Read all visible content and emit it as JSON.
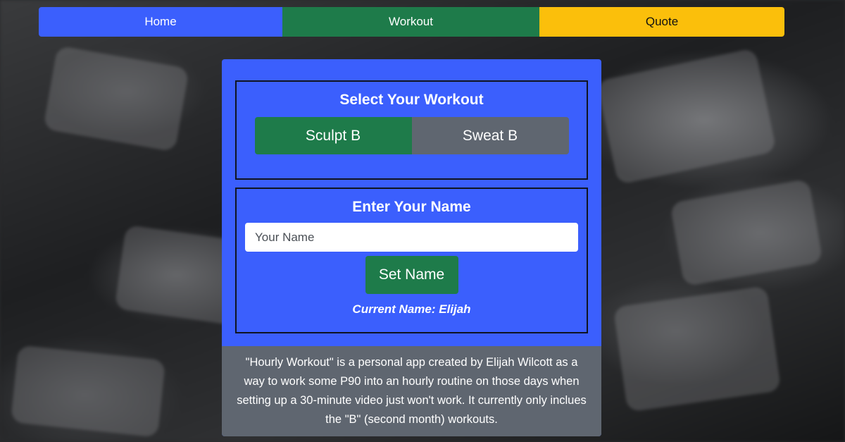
{
  "nav": {
    "home": "Home",
    "workout": "Workout",
    "quote": "Quote"
  },
  "workout_section": {
    "title": "Select Your Workout",
    "options": [
      "Sculpt B",
      "Sweat B"
    ],
    "selected": "Sculpt B"
  },
  "name_section": {
    "title": "Enter Your Name",
    "input_placeholder": "Your Name",
    "input_value": "",
    "button_label": "Set Name",
    "current_name": "Current Name: Elijah"
  },
  "about": {
    "text": "\"Hourly Workout\" is a personal app created by Elijah Wilcott as a way to work some P90 into an hourly routine on those days when setting up a 30-minute video just won't work. It currently only inclues the \"B\" (second month) workouts."
  },
  "colors": {
    "primary_blue": "#3b5ffd",
    "green": "#1e7b4a",
    "yellow": "#fbbf0b",
    "gray": "#5f6670"
  }
}
